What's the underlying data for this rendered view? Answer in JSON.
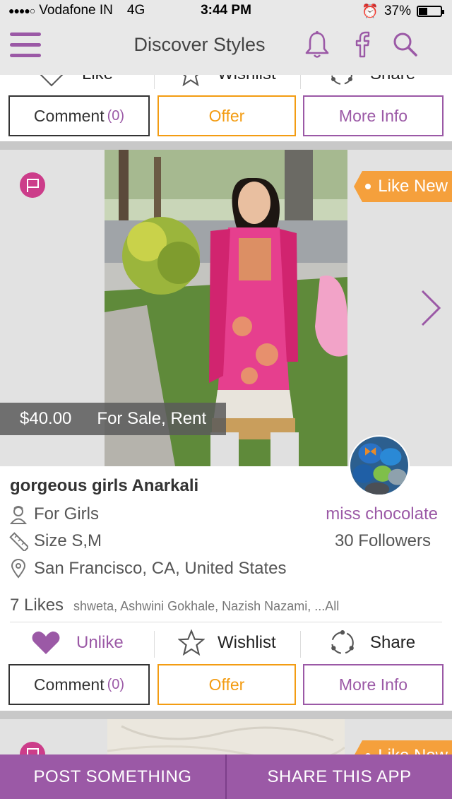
{
  "status_bar": {
    "carrier": "Vodafone IN",
    "network": "4G",
    "time": "3:44 PM",
    "battery": "37%",
    "battery_level": 0.37
  },
  "nav": {
    "title": "Discover Styles",
    "icons": [
      "menu-icon",
      "bell-icon",
      "facebook-icon",
      "search-icon"
    ]
  },
  "prev_post": {
    "actions": {
      "like": "Like",
      "wishlist": "Wishlist",
      "share": "Share"
    },
    "buttons": {
      "comment": "Comment",
      "comment_count": "(0)",
      "offer": "Offer",
      "more_info": "More Info"
    }
  },
  "post": {
    "condition": "Like New",
    "price": "$40.00",
    "sale_type": "For Sale, Rent",
    "title": "gorgeous girls Anarkali",
    "category": "For Girls",
    "size": "Size S,M",
    "location": "San Francisco, CA, United States",
    "seller": "miss chocolate",
    "followers": "30 Followers",
    "likes": "7 Likes",
    "likers": "shweta, Ashwini Gokhale, Nazish Nazami, ...All",
    "actions": {
      "unlike": "Unlike",
      "wishlist": "Wishlist",
      "share": "Share"
    },
    "buttons": {
      "comment": "Comment",
      "comment_count": "(0)",
      "offer": "Offer",
      "more_info": "More Info"
    }
  },
  "next_post": {
    "condition": "Like New"
  },
  "bottom_bar": {
    "post": "POST SOMETHING",
    "share": "SHARE THIS APP"
  },
  "colors": {
    "accent": "#9b59a6",
    "offer": "#f39c12",
    "tag": "#f5a03c",
    "flag": "#cc3d8a"
  }
}
